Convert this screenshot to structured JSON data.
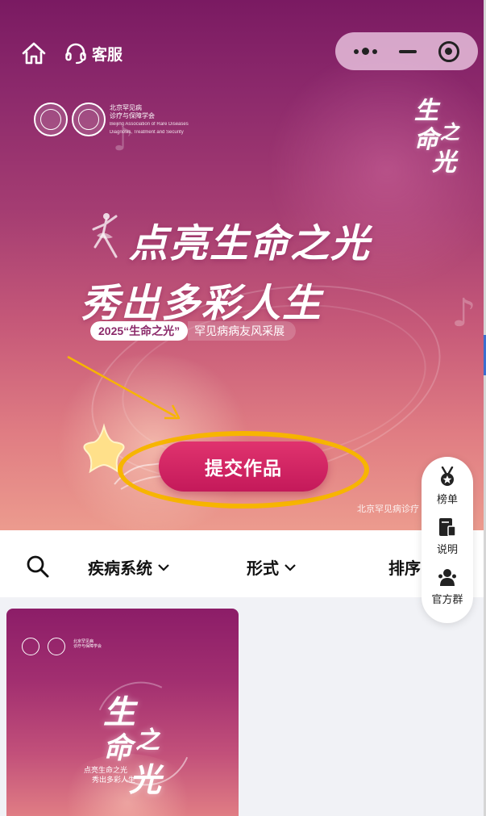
{
  "nav": {
    "service_label": "客服"
  },
  "org": {
    "name_cn": "北京罕见病",
    "name_cn2": "诊疗与保障学会",
    "name_en": "Beijing Association of Rare Diseases",
    "name_en2": "Diagnosis, Treatment and Security"
  },
  "hero": {
    "brand": [
      "生",
      "命",
      "之",
      "光"
    ],
    "title_line1": "点亮生命之光",
    "title_line2": "秀出多彩人生",
    "subtitle_year": "2025“生命之光”",
    "subtitle_rest": "罕见病病友风采展",
    "submit_label": "提交作品",
    "footer_note": "北京罕见病诊疗"
  },
  "filters": [
    {
      "label": "疾病系统"
    },
    {
      "label": "形式"
    },
    {
      "label": "排序"
    }
  ],
  "side_menu": [
    {
      "label": "榜单",
      "icon": "medal-icon"
    },
    {
      "label": "说明",
      "icon": "document-icon"
    },
    {
      "label": "官方群",
      "icon": "group-icon"
    }
  ],
  "card": {
    "brand": [
      "生",
      "命",
      "之",
      "光"
    ],
    "sub_line1": "点亮生命之光",
    "sub_line2": "秀出多彩人生"
  },
  "colors": {
    "accent": "#c4195a",
    "highlight_ring": "#f7b500",
    "hero_top": "#7a1a62",
    "hero_bottom": "#ec9b8e"
  }
}
